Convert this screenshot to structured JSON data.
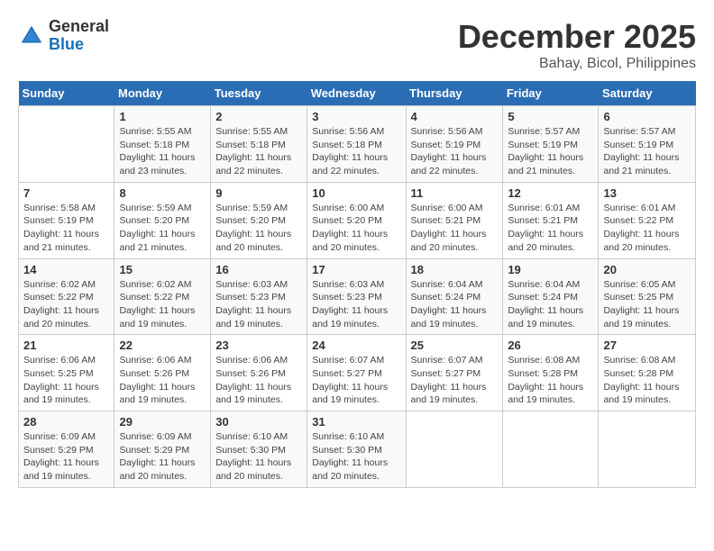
{
  "logo": {
    "general": "General",
    "blue": "Blue"
  },
  "title": {
    "month": "December 2025",
    "location": "Bahay, Bicol, Philippines"
  },
  "days_of_week": [
    "Sunday",
    "Monday",
    "Tuesday",
    "Wednesday",
    "Thursday",
    "Friday",
    "Saturday"
  ],
  "weeks": [
    [
      {
        "num": "",
        "info": ""
      },
      {
        "num": "1",
        "info": "Sunrise: 5:55 AM\nSunset: 5:18 PM\nDaylight: 11 hours\nand 23 minutes."
      },
      {
        "num": "2",
        "info": "Sunrise: 5:55 AM\nSunset: 5:18 PM\nDaylight: 11 hours\nand 22 minutes."
      },
      {
        "num": "3",
        "info": "Sunrise: 5:56 AM\nSunset: 5:18 PM\nDaylight: 11 hours\nand 22 minutes."
      },
      {
        "num": "4",
        "info": "Sunrise: 5:56 AM\nSunset: 5:19 PM\nDaylight: 11 hours\nand 22 minutes."
      },
      {
        "num": "5",
        "info": "Sunrise: 5:57 AM\nSunset: 5:19 PM\nDaylight: 11 hours\nand 21 minutes."
      },
      {
        "num": "6",
        "info": "Sunrise: 5:57 AM\nSunset: 5:19 PM\nDaylight: 11 hours\nand 21 minutes."
      }
    ],
    [
      {
        "num": "7",
        "info": "Sunrise: 5:58 AM\nSunset: 5:19 PM\nDaylight: 11 hours\nand 21 minutes."
      },
      {
        "num": "8",
        "info": "Sunrise: 5:59 AM\nSunset: 5:20 PM\nDaylight: 11 hours\nand 21 minutes."
      },
      {
        "num": "9",
        "info": "Sunrise: 5:59 AM\nSunset: 5:20 PM\nDaylight: 11 hours\nand 20 minutes."
      },
      {
        "num": "10",
        "info": "Sunrise: 6:00 AM\nSunset: 5:20 PM\nDaylight: 11 hours\nand 20 minutes."
      },
      {
        "num": "11",
        "info": "Sunrise: 6:00 AM\nSunset: 5:21 PM\nDaylight: 11 hours\nand 20 minutes."
      },
      {
        "num": "12",
        "info": "Sunrise: 6:01 AM\nSunset: 5:21 PM\nDaylight: 11 hours\nand 20 minutes."
      },
      {
        "num": "13",
        "info": "Sunrise: 6:01 AM\nSunset: 5:22 PM\nDaylight: 11 hours\nand 20 minutes."
      }
    ],
    [
      {
        "num": "14",
        "info": "Sunrise: 6:02 AM\nSunset: 5:22 PM\nDaylight: 11 hours\nand 20 minutes."
      },
      {
        "num": "15",
        "info": "Sunrise: 6:02 AM\nSunset: 5:22 PM\nDaylight: 11 hours\nand 19 minutes."
      },
      {
        "num": "16",
        "info": "Sunrise: 6:03 AM\nSunset: 5:23 PM\nDaylight: 11 hours\nand 19 minutes."
      },
      {
        "num": "17",
        "info": "Sunrise: 6:03 AM\nSunset: 5:23 PM\nDaylight: 11 hours\nand 19 minutes."
      },
      {
        "num": "18",
        "info": "Sunrise: 6:04 AM\nSunset: 5:24 PM\nDaylight: 11 hours\nand 19 minutes."
      },
      {
        "num": "19",
        "info": "Sunrise: 6:04 AM\nSunset: 5:24 PM\nDaylight: 11 hours\nand 19 minutes."
      },
      {
        "num": "20",
        "info": "Sunrise: 6:05 AM\nSunset: 5:25 PM\nDaylight: 11 hours\nand 19 minutes."
      }
    ],
    [
      {
        "num": "21",
        "info": "Sunrise: 6:06 AM\nSunset: 5:25 PM\nDaylight: 11 hours\nand 19 minutes."
      },
      {
        "num": "22",
        "info": "Sunrise: 6:06 AM\nSunset: 5:26 PM\nDaylight: 11 hours\nand 19 minutes."
      },
      {
        "num": "23",
        "info": "Sunrise: 6:06 AM\nSunset: 5:26 PM\nDaylight: 11 hours\nand 19 minutes."
      },
      {
        "num": "24",
        "info": "Sunrise: 6:07 AM\nSunset: 5:27 PM\nDaylight: 11 hours\nand 19 minutes."
      },
      {
        "num": "25",
        "info": "Sunrise: 6:07 AM\nSunset: 5:27 PM\nDaylight: 11 hours\nand 19 minutes."
      },
      {
        "num": "26",
        "info": "Sunrise: 6:08 AM\nSunset: 5:28 PM\nDaylight: 11 hours\nand 19 minutes."
      },
      {
        "num": "27",
        "info": "Sunrise: 6:08 AM\nSunset: 5:28 PM\nDaylight: 11 hours\nand 19 minutes."
      }
    ],
    [
      {
        "num": "28",
        "info": "Sunrise: 6:09 AM\nSunset: 5:29 PM\nDaylight: 11 hours\nand 19 minutes."
      },
      {
        "num": "29",
        "info": "Sunrise: 6:09 AM\nSunset: 5:29 PM\nDaylight: 11 hours\nand 20 minutes."
      },
      {
        "num": "30",
        "info": "Sunrise: 6:10 AM\nSunset: 5:30 PM\nDaylight: 11 hours\nand 20 minutes."
      },
      {
        "num": "31",
        "info": "Sunrise: 6:10 AM\nSunset: 5:30 PM\nDaylight: 11 hours\nand 20 minutes."
      },
      {
        "num": "",
        "info": ""
      },
      {
        "num": "",
        "info": ""
      },
      {
        "num": "",
        "info": ""
      }
    ]
  ]
}
